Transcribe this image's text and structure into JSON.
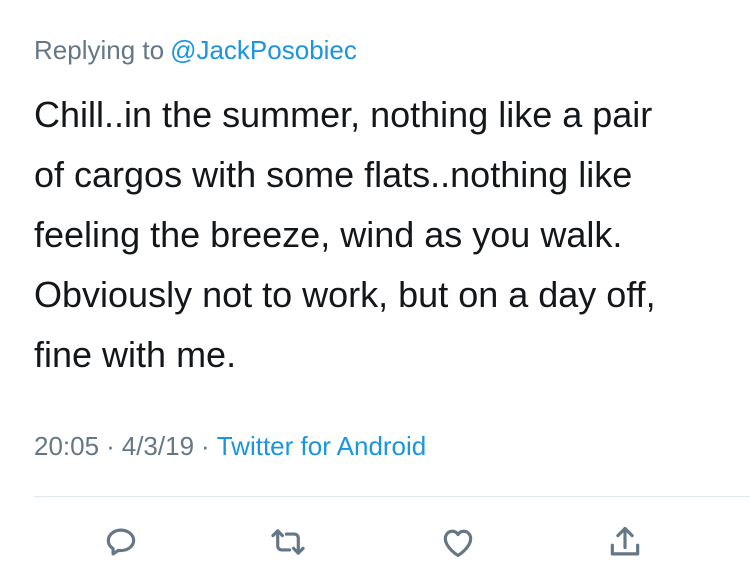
{
  "reply": {
    "prefix": "Replying to",
    "handle": "@JackPosobiec"
  },
  "tweet": {
    "lines": [
      "Chill..in the summer, nothing like a pair",
      "of cargos with some flats..nothing like",
      "feeling the breeze, wind as you walk.",
      "Obviously not to work, but on a day off,",
      "fine with me."
    ]
  },
  "meta": {
    "time": "20:05",
    "separator": "·",
    "date": "4/3/19",
    "source": "Twitter for Android"
  },
  "actions": {
    "icons": [
      "reply-icon",
      "retweet-icon",
      "like-icon",
      "share-icon"
    ]
  },
  "colors": {
    "link": "#1b95e0",
    "muted": "#657786",
    "text": "#14171a",
    "divider": "#e1e8ed"
  }
}
